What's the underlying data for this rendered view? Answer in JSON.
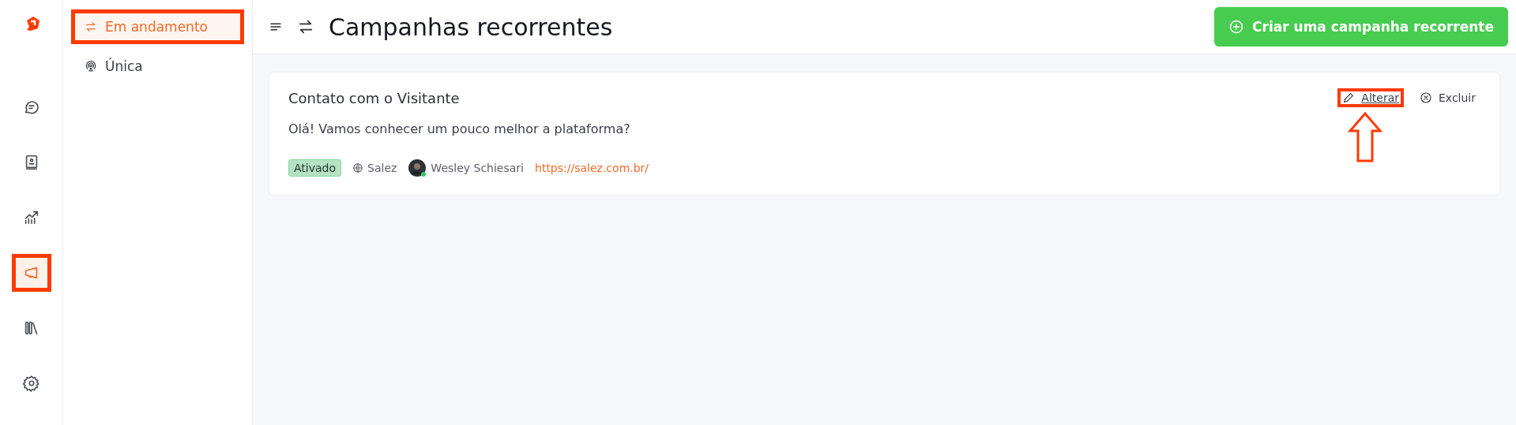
{
  "rail": {
    "items": [
      {
        "kind": "chat",
        "selected": false,
        "highlighted": false
      },
      {
        "kind": "contacts",
        "selected": false,
        "highlighted": false
      },
      {
        "kind": "reports",
        "selected": false,
        "highlighted": false
      },
      {
        "kind": "campaigns",
        "selected": true,
        "highlighted": true
      },
      {
        "kind": "library",
        "selected": false,
        "highlighted": false
      },
      {
        "kind": "settings",
        "selected": false,
        "highlighted": false
      }
    ]
  },
  "subnav": {
    "items": [
      {
        "label": "Em andamento",
        "kind": "recurring",
        "selected": true,
        "highlighted": true
      },
      {
        "label": "Única",
        "kind": "single",
        "selected": false,
        "highlighted": false
      }
    ]
  },
  "header": {
    "title": "Campanhas recorrentes",
    "button": "Criar uma campanha recorrente"
  },
  "campaigns": [
    {
      "title": "Contato com o Visitante",
      "message": "Olá! Vamos conhecer um pouco melhor a plataforma?",
      "status": "Ativado",
      "site": "Salez",
      "author": "Wesley Schiesari",
      "url": "https://salez.com.br/",
      "actions": [
        {
          "label": "Alterar",
          "kind": "edit",
          "highlighted": true
        },
        {
          "label": "Excluir",
          "kind": "delete",
          "highlighted": false
        }
      ]
    }
  ]
}
